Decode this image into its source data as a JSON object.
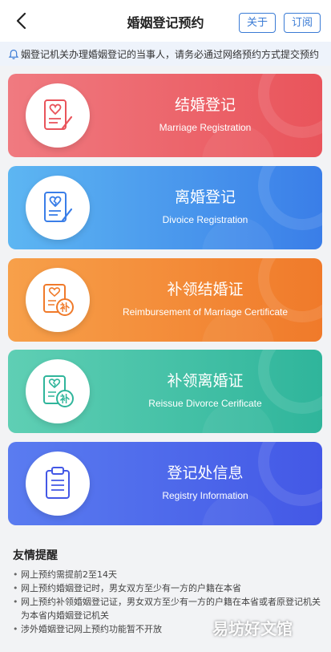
{
  "header": {
    "title": "婚姻登记预约",
    "about_label": "关于",
    "subscribe_label": "订阅"
  },
  "notice": {
    "text": "姻登记机关办理婚姻登记的当事人，请务必通过网络预约方式提交预约"
  },
  "cards": [
    {
      "cn": "结婚登记",
      "en": "Marriage Registration",
      "icon": "heart-document-icon"
    },
    {
      "cn": "离婚登记",
      "en": "Divoice Registration",
      "icon": "broken-heart-document-icon"
    },
    {
      "cn": "补领结婚证",
      "en": "Reimbursement of Marriage Certificate",
      "icon": "reissue-certificate-icon"
    },
    {
      "cn": "补领离婚证",
      "en": "Reissue Divorce Cerificate",
      "icon": "reissue-certificate-icon"
    },
    {
      "cn": "登记处信息",
      "en": "Registry Information",
      "icon": "clipboard-icon"
    }
  ],
  "tips": {
    "title": "友情提醒",
    "items": [
      "网上预约需提前2至14天",
      "网上预约婚姻登记时，男女双方至少有一方的户籍在本省",
      "网上预约补领婚姻登记证，男女双方至少有一方的户籍在本省或者原登记机关为本省内婚姻登记机关",
      "涉外婚姻登记网上预约功能暂不开放"
    ]
  },
  "watermark": "易坊好文馆",
  "colors": {
    "accent": "#3a7bd5",
    "marriage": "#e9545b",
    "divorce": "#3a7ee8",
    "reissue_marriage": "#f07a2a",
    "reissue_divorce": "#2fb59b",
    "registry": "#4358e6"
  }
}
